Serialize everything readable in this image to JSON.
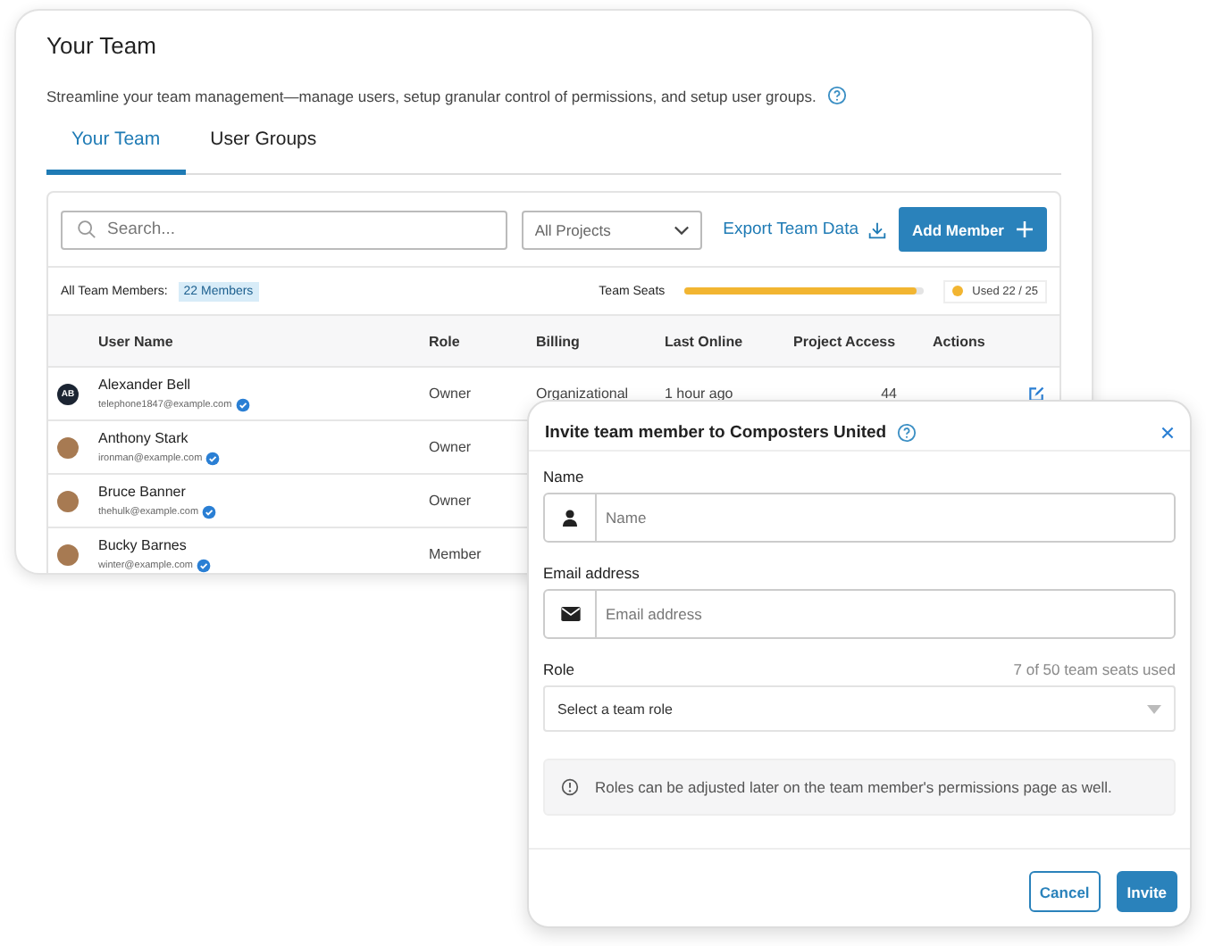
{
  "page": {
    "title": "Your Team",
    "description": "Streamline your team management—manage users, setup granular control of permissions, and setup user groups."
  },
  "tabs": [
    {
      "label": "Your Team",
      "selected": true
    },
    {
      "label": "User Groups",
      "selected": false
    }
  ],
  "toolbar": {
    "search_placeholder": "Search...",
    "project_filter": "All Projects",
    "export_link": "Export Team Data",
    "add_button": "Add Member"
  },
  "summary": {
    "members_label": "All Team Members:",
    "members_badge": "22 Members",
    "seats_label": "Team Seats",
    "seats": {
      "level": 0.97
    },
    "seats_used": "Used 22 / 25"
  },
  "table": {
    "columns": [
      "User Name",
      "Role",
      "Billing",
      "Last Online",
      "Project Access",
      "Actions"
    ],
    "rows": [
      {
        "avatar": {
          "kind": "initials",
          "text": "AB"
        },
        "name": "Alexander Bell",
        "email": "telephone1847@example.com",
        "role": "Owner",
        "billing": "Organizational",
        "last_online": "1 hour ago",
        "project_access": "44"
      },
      {
        "avatar": {
          "kind": "photo"
        },
        "name": "Anthony Stark",
        "email": "ironman@example.com",
        "role": "Owner"
      },
      {
        "avatar": {
          "kind": "photo"
        },
        "name": "Bruce Banner",
        "email": "thehulk@example.com",
        "role": "Owner"
      },
      {
        "avatar": {
          "kind": "photo"
        },
        "name": "Bucky Barnes",
        "email": "winter@example.com",
        "role": "Member"
      }
    ]
  },
  "dialog": {
    "title": "Invite team member to Composters United",
    "name_label": "Name",
    "name_placeholder": "Name",
    "email_label": "Email address",
    "email_placeholder": "Email address",
    "role_label": "Role",
    "seats_note": "7 of 50 team seats used",
    "role_placeholder": "Select a team role",
    "info": "Roles can be adjusted later on the team member's permissions page as well.",
    "buttons": [
      {
        "label": "Cancel",
        "kind": "secondary"
      },
      {
        "label": "Invite",
        "kind": "primary"
      }
    ]
  }
}
